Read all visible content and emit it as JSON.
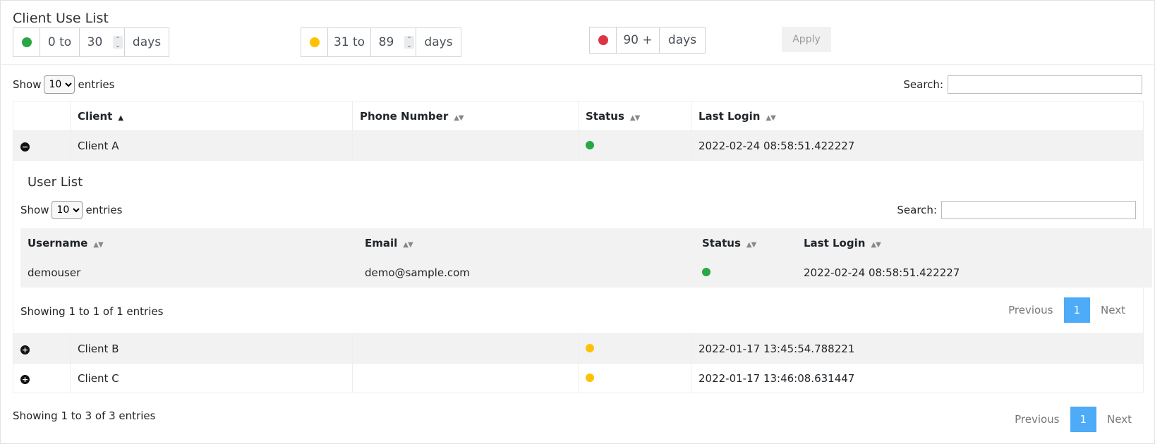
{
  "page": {
    "title": "Client Use List"
  },
  "filters": {
    "green": {
      "color": "#28a745",
      "from": "0 to",
      "to": "30",
      "unit": "days"
    },
    "yellow": {
      "color": "#ffc107",
      "from": "31 to",
      "to": "89",
      "unit": "days"
    },
    "red": {
      "color": "#dc3545",
      "from": "90 +",
      "unit": "days"
    },
    "apply_label": "Apply"
  },
  "clients_table": {
    "show_label": "Show",
    "entries_label": "entries",
    "page_length": "10",
    "search_label": "Search:",
    "columns": [
      "Client",
      "Phone Number",
      "Status",
      "Last Login"
    ],
    "rows": [
      {
        "client": "Client A",
        "phone": "",
        "status": "green",
        "last_login": "2022-02-24 08:58:51.422227",
        "expanded": true
      },
      {
        "client": "Client B",
        "phone": "",
        "status": "yellow",
        "last_login": "2022-01-17 13:45:54.788221",
        "expanded": false
      },
      {
        "client": "Client C",
        "phone": "",
        "status": "yellow",
        "last_login": "2022-01-17 13:46:08.631447",
        "expanded": false
      }
    ],
    "info": "Showing 1 to 3 of 3 entries",
    "pager": {
      "previous": "Previous",
      "current": "1",
      "next": "Next"
    }
  },
  "user_list": {
    "title": "User List",
    "show_label": "Show",
    "entries_label": "entries",
    "page_length": "10",
    "search_label": "Search:",
    "columns": [
      "Username",
      "Email",
      "Status",
      "Last Login"
    ],
    "rows": [
      {
        "username": "demouser",
        "email": "demo@sample.com",
        "status": "green",
        "last_login": "2022-02-24 08:58:51.422227"
      }
    ],
    "info": "Showing 1 to 1 of 1 entries",
    "pager": {
      "previous": "Previous",
      "current": "1",
      "next": "Next"
    }
  },
  "status_colors": {
    "green": "#28a745",
    "yellow": "#ffc107",
    "red": "#dc3545"
  }
}
